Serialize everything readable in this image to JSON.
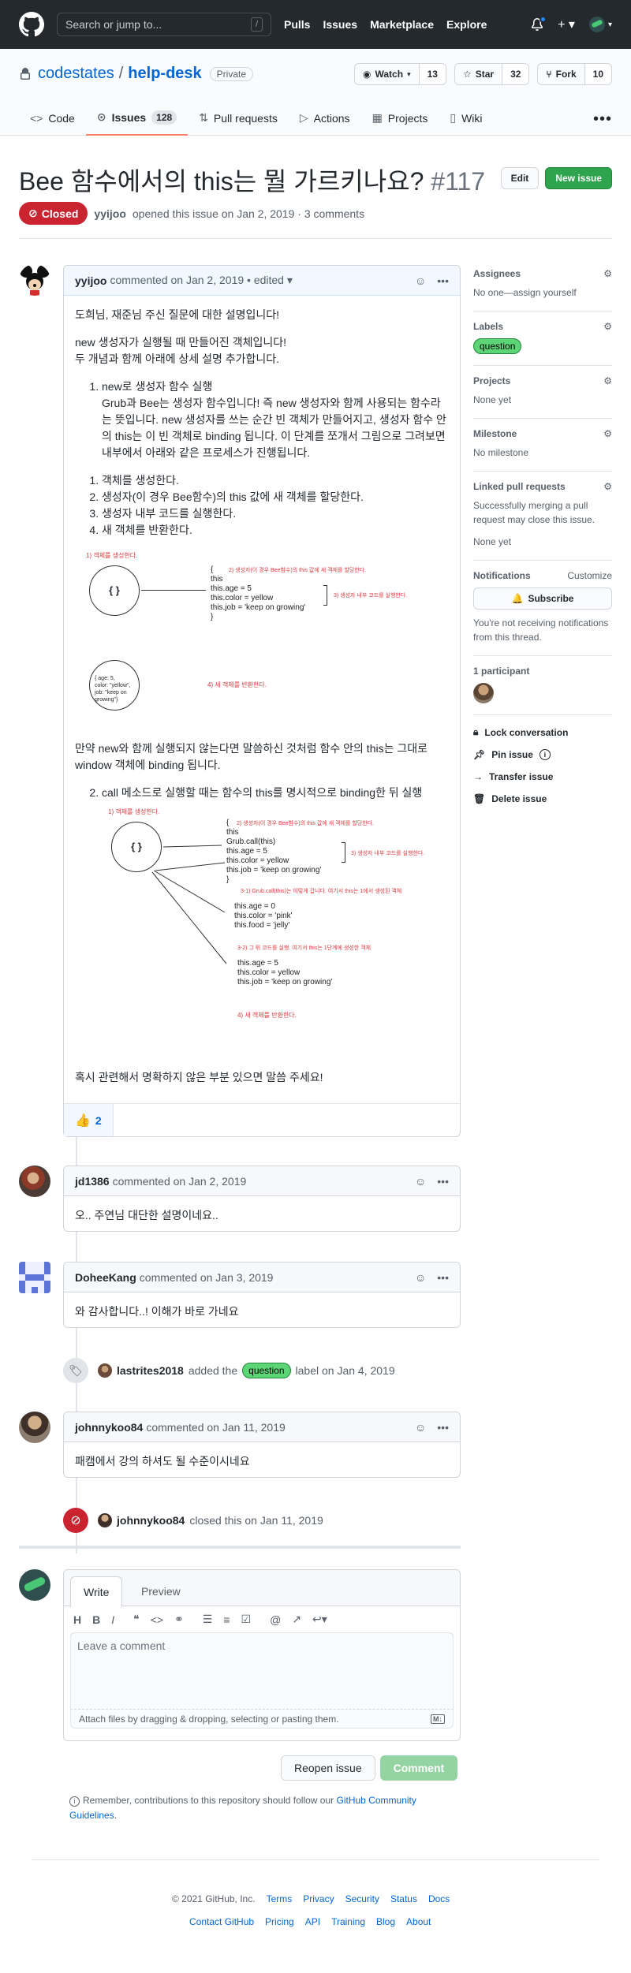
{
  "header": {
    "search_placeholder": "Search or jump to...",
    "slash_key": "/",
    "nav": [
      "Pulls",
      "Issues",
      "Marketplace",
      "Explore"
    ],
    "plus_caret": "+ ▾"
  },
  "repo": {
    "owner": "codestates",
    "separator": "/",
    "name": "help-desk",
    "visibility": "Private",
    "watch_label": "Watch",
    "watch_count": "13",
    "star_label": "Star",
    "star_count": "32",
    "fork_label": "Fork",
    "fork_count": "10",
    "tabs": [
      {
        "label": "Code",
        "icon": "code-icon"
      },
      {
        "label": "Issues",
        "count": "128",
        "icon": "issue-icon"
      },
      {
        "label": "Pull requests",
        "icon": "pull-request-icon"
      },
      {
        "label": "Actions",
        "icon": "play-icon"
      },
      {
        "label": "Projects",
        "icon": "project-icon"
      },
      {
        "label": "Wiki",
        "icon": "book-icon"
      }
    ],
    "more": "•••"
  },
  "issue": {
    "title": "Bee 함수에서의 this는 뭘 가르키나요?",
    "number": "#117",
    "edit_label": "Edit",
    "new_issue_label": "New issue",
    "state": "Closed",
    "author": "yyijoo",
    "meta_rest": "opened this issue on Jan 2, 2019 · 3 comments"
  },
  "main_comment": {
    "author": "yyijoo",
    "meta": "commented on Jan 2, 2019 • edited ▾",
    "p1": "도희님, 재준님 주신 질문에 대한 설명입니다!",
    "p2a": "new 생성자가 실행될 때 만들어진 객체입니다!",
    "p2b": "두 개념과 함께 아래에 상세 설명 추가합니다.",
    "li1_title": "new로 생성자 함수 실행",
    "li1_text": "Grub과 Bee는 생성자 함수입니다! 즉 new 생성자와 함께 사용되는 함수라는 뜻입니다. new 생성자를 쓰는 순간 빈 객체가 만들어지고, 생성자 함수 안의 this는 이 빈 객체로 binding 됩니다. 이 단계를 쪼개서 그림으로 그려보면 내부에서 아래와 같은 프로세스가 진행됩니다.",
    "steps": [
      "객체를 생성한다.",
      "생성자(이 경우 Bee함수)의 this 값에 새 객체를 할당한다.",
      "생성자 내부 코드를 실행한다.",
      "새 객체를 반환한다."
    ],
    "fig1": {
      "s1": "1) 객체를 생성한다.",
      "braces": "{ }",
      "code": [
        "{",
        "this",
        "this.age = 5",
        "this.color = yellow",
        "this.job = 'keep on growing'",
        "}"
      ],
      "s2": "2) 생성자(이 경우 Bee함수)의 this 값에 새 객체를 할당한다.",
      "s3": "3) 생성자 내부 코드를 실행한다.",
      "obj": [
        "{ age: 5,",
        "color: \"yellow\",",
        "job: \"keep on growing\"}"
      ],
      "s4": "4) 새 객체를 반환한다."
    },
    "p3": "만약 new와 함께 실행되지 않는다면 말씀하신 것처럼 함수 안의 this는 그대로 window 객체에 binding 됩니다.",
    "li2": "call 메소드로 실행할 때는 함수의 this를 명시적으로 binding한 뒤 실행",
    "fig2": {
      "s1": "1) 객체를 생성한다.",
      "braces": "{ }",
      "code": [
        "{",
        "this",
        "Grub.call(this)",
        "this.age = 5",
        "this.color = yellow",
        "this.job = 'keep on growing'",
        "}"
      ],
      "s2": "2) 생성자(이 경우 Bee함수)의 this 값에 새 객체를 할당한다.",
      "s3": "3) 생성자 내부 코드를 실행한다.",
      "s31": "3-1) Grub.call(this)는 이렇게 갑니다. 여기서 this는 1에서 생성된 객체",
      "code2": [
        "this.age = 0",
        "this.color = 'pink'",
        "this.food = 'jelly'"
      ],
      "s32": "3-2) 그 뒤 코드를 실행. 여기서 this는 1단계에 생성한 객체",
      "code3": [
        "this.age = 5",
        "this.color = yellow",
        "this.job = 'keep on growing'"
      ],
      "s4": "4) 새 객체를 반환한다."
    },
    "p4": "혹시 관련해서 명확하지 않은 부분 있으면 말씀 주세요!",
    "reaction_emoji": "👍",
    "reaction_count": "2"
  },
  "comments": [
    {
      "author": "jd1386",
      "meta": "commented on Jan 2, 2019",
      "body": "오.. 주연님 대단한 설명이네요.."
    },
    {
      "author": "DoheeKang",
      "meta": "commented on Jan 3, 2019",
      "body": "와 감사합니다..! 이해가 바로 가네요"
    },
    {
      "author": "johnnykoo84",
      "meta": "commented on Jan 11, 2019",
      "body": "패캠에서 강의 하셔도 될 수준이시네요"
    }
  ],
  "events": {
    "label_actor": "lastrites2018",
    "label_pre": "added the",
    "label_name": "question",
    "label_post": "label on Jan 4, 2019",
    "close_actor": "johnnykoo84",
    "close_text": "closed this on Jan 11, 2019"
  },
  "sidebar": {
    "assignees_h": "Assignees",
    "assignees_v": "No one—assign yourself",
    "labels_h": "Labels",
    "labels_v": "question",
    "projects_h": "Projects",
    "projects_v": "None yet",
    "milestone_h": "Milestone",
    "milestone_v": "No milestone",
    "linked_h": "Linked pull requests",
    "linked_v": "Successfully merging a pull request may close this issue.",
    "linked_v2": "None yet",
    "notif_h": "Notifications",
    "notif_customize": "Customize",
    "subscribe": "Subscribe",
    "notif_v": "You're not receiving notifications from this thread.",
    "participants_h": "1 participant",
    "lock": "Lock conversation",
    "pin": "Pin issue",
    "transfer": "Transfer issue",
    "delete": "Delete issue"
  },
  "composer": {
    "tab_write": "Write",
    "tab_preview": "Preview",
    "placeholder": "Leave a comment",
    "attach": "Attach files by dragging & dropping, selecting or pasting them.",
    "md_badge": "M↓",
    "reopen": "Reopen issue",
    "comment": "Comment",
    "remember_pre": "Remember, contributions to this repository should follow our",
    "guidelines": "GitHub Community Guidelines",
    "remember_post": "."
  },
  "footer": {
    "copyright": "© 2021 GitHub, Inc.",
    "row1": [
      "Terms",
      "Privacy",
      "Security",
      "Status",
      "Docs"
    ],
    "row2": [
      "Contact GitHub",
      "Pricing",
      "API",
      "Training",
      "Blog",
      "About"
    ]
  },
  "colors": {
    "closed": "#cb2431",
    "green": "#2ea44f",
    "link": "#0366d6",
    "annot_red": "#e0393e"
  }
}
